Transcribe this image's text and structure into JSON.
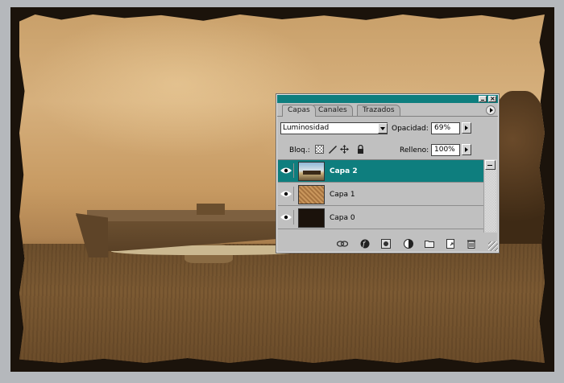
{
  "layers_panel": {
    "tabs": [
      "Capas",
      "Canales",
      "Trazados"
    ],
    "blend_mode": "Luminosidad",
    "opacity_label": "Opacidad:",
    "opacity_value": "69%",
    "lock_label": "Bloq.:",
    "fill_label": "Relleno:",
    "fill_value": "100%",
    "layers": [
      {
        "name": "Capa 2",
        "selected": true,
        "visible": true
      },
      {
        "name": "Capa 1",
        "selected": false,
        "visible": true
      },
      {
        "name": "Capa 0",
        "selected": false,
        "visible": true
      }
    ],
    "accent_color": "#0e7e7e"
  },
  "icons": {
    "panel_menu": "panel-menu-icon",
    "lock": [
      "lock-transparency-icon",
      "lock-brush-icon",
      "lock-move-icon",
      "lock-all-icon"
    ],
    "bottom": [
      "link-icon",
      "layer-style-icon",
      "layer-mask-icon",
      "adjustment-layer-icon",
      "new-group-icon",
      "new-layer-icon",
      "trash-icon"
    ]
  }
}
